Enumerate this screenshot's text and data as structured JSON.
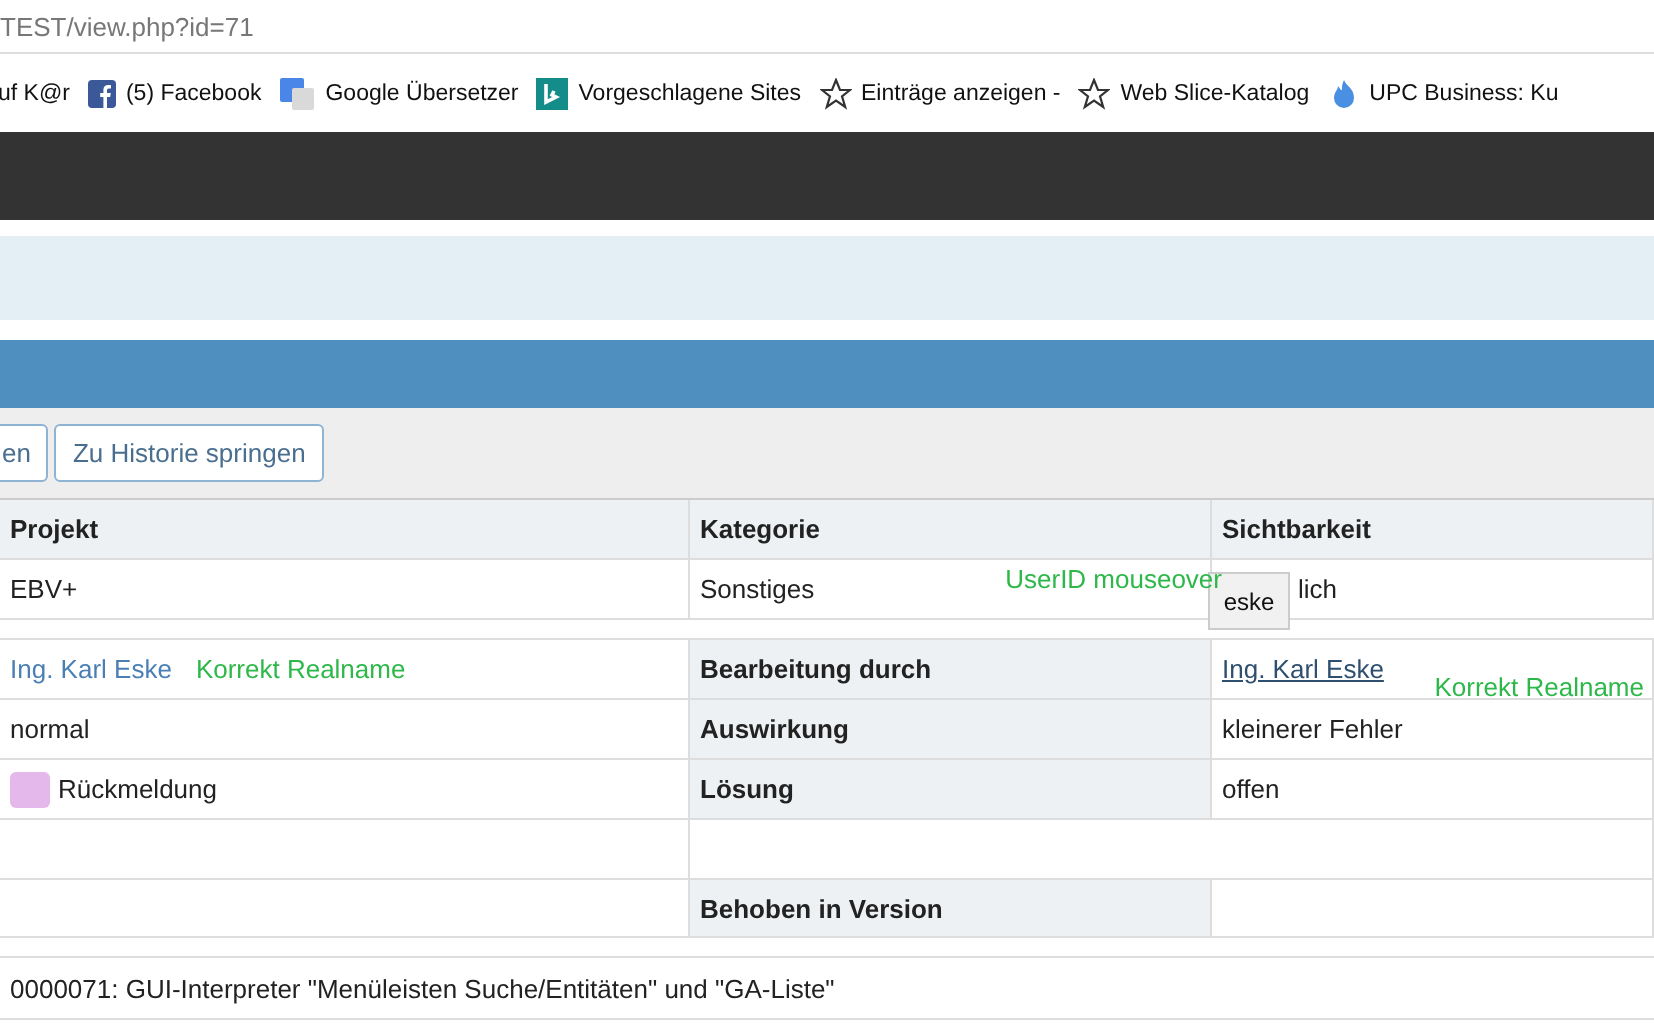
{
  "address_bar": {
    "url": "TEST/view.php?id=71"
  },
  "bookmarks": [
    {
      "label": "uf K@r"
    },
    {
      "label": "(5) Facebook"
    },
    {
      "label": "Google Übersetzer"
    },
    {
      "label": "Vorgeschlagene Sites"
    },
    {
      "label": "Einträge anzeigen -"
    },
    {
      "label": "Web Slice-Katalog"
    },
    {
      "label": "UPC Business: Ku"
    }
  ],
  "toolbar": {
    "buttons": [
      "en",
      "Zu Historie springen"
    ]
  },
  "details": [
    {
      "cells": [
        {
          "kind": "header",
          "text": "Projekt"
        },
        {
          "kind": "header",
          "text": "Kategorie"
        },
        {
          "kind": "header",
          "text": "Sichtbarkeit"
        }
      ]
    },
    {
      "cells": [
        {
          "kind": "value",
          "text": "EBV+"
        },
        {
          "kind": "value",
          "text": "Sonstiges",
          "note": "UserID mouseover"
        },
        {
          "kind": "value",
          "text": "lich",
          "tooltip": "eske"
        }
      ]
    }
  ],
  "fields": [
    {
      "cells": [
        {
          "kind": "link",
          "text": "Ing. Karl Eske",
          "note": "Korrekt Realname"
        },
        {
          "kind": "label",
          "text": "Bearbeitung durch"
        },
        {
          "kind": "ulink",
          "text": "Ing. Karl Eske",
          "note": "Korrekt Realname"
        }
      ]
    },
    {
      "cells": [
        {
          "kind": "value",
          "text": "normal"
        },
        {
          "kind": "label",
          "text": "Auswirkung"
        },
        {
          "kind": "value",
          "text": "kleinerer Fehler"
        }
      ]
    },
    {
      "cells": [
        {
          "kind": "status",
          "text": "Rückmeldung",
          "color": "#e4b8ea"
        },
        {
          "kind": "label",
          "text": "Lösung"
        },
        {
          "kind": "value",
          "text": "offen"
        }
      ]
    },
    {
      "cells": [
        {
          "kind": "empty"
        },
        {
          "kind": "wide"
        }
      ]
    },
    {
      "cells": [
        {
          "kind": "empty"
        },
        {
          "kind": "label",
          "text": "Behoben in Version"
        },
        {
          "kind": "empty"
        }
      ]
    }
  ],
  "summary": "0000071: GUI-Interpreter \"Menüleisten Suche/Entitäten\" und \"GA-Liste\""
}
